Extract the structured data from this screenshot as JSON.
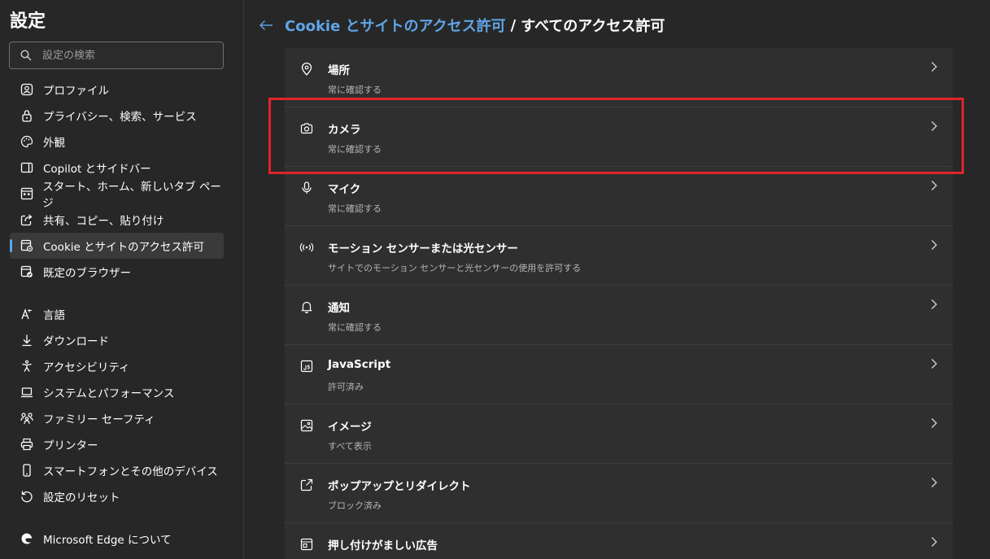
{
  "sidebar": {
    "title": "設定",
    "search": {
      "placeholder": "設定の検索",
      "icon": "search-icon"
    },
    "items": [
      {
        "label": "プロファイル",
        "icon": "profile-icon"
      },
      {
        "label": "プライバシー、検索、サービス",
        "icon": "lock-icon"
      },
      {
        "label": "外観",
        "icon": "palette-icon"
      },
      {
        "label": "Copilot とサイドバー",
        "icon": "sidebar-icon"
      },
      {
        "label": "スタート、ホーム、新しいタブ ページ",
        "icon": "home-grid-icon"
      },
      {
        "label": "共有、コピー、貼り付け",
        "icon": "share-icon"
      },
      {
        "label": "Cookie とサイトのアクセス許可",
        "icon": "site-permissions-icon",
        "active": true
      },
      {
        "label": "既定のブラウザー",
        "icon": "default-browser-icon"
      }
    ],
    "items2": [
      {
        "label": "言語",
        "icon": "language-icon"
      },
      {
        "label": "ダウンロード",
        "icon": "download-icon"
      },
      {
        "label": "アクセシビリティ",
        "icon": "accessibility-icon"
      },
      {
        "label": "システムとパフォーマンス",
        "icon": "laptop-icon"
      },
      {
        "label": "ファミリー セーフティ",
        "icon": "family-icon"
      },
      {
        "label": "プリンター",
        "icon": "printer-icon"
      },
      {
        "label": "スマートフォンとその他のデバイス",
        "icon": "phone-icon"
      },
      {
        "label": "設定のリセット",
        "icon": "reset-icon"
      }
    ],
    "about": {
      "label": "Microsoft Edge について",
      "icon": "edge-logo-icon"
    }
  },
  "header": {
    "back_icon": "back-arrow-icon",
    "crumb_link": "Cookie とサイトのアクセス許可",
    "separator": "/",
    "current": "すべてのアクセス許可"
  },
  "permissions": [
    {
      "title": "場所",
      "sub": "常に確認する",
      "icon": "location-icon"
    },
    {
      "title": "カメラ",
      "sub": "常に確認する",
      "icon": "camera-icon"
    },
    {
      "title": "マイク",
      "sub": "常に確認する",
      "icon": "microphone-icon"
    },
    {
      "title": "モーション センサーまたは光センサー",
      "sub": "サイトでのモーション センサーと光センサーの使用を許可する",
      "icon": "sensor-icon"
    },
    {
      "title": "通知",
      "sub": "常に確認する",
      "icon": "bell-icon"
    },
    {
      "title": "JavaScript",
      "sub": "許可済み",
      "icon": "javascript-icon"
    },
    {
      "title": "イメージ",
      "sub": "すべて表示",
      "icon": "image-icon"
    },
    {
      "title": "ポップアップとリダイレクト",
      "sub": "ブロック済み",
      "icon": "popup-icon"
    },
    {
      "title": "押し付けがましい広告",
      "sub": "",
      "icon": "ads-icon"
    }
  ],
  "colors": {
    "accent": "#60a5e8",
    "highlight": "#e0242b",
    "background": "#272727",
    "card": "#2f2f2f"
  }
}
